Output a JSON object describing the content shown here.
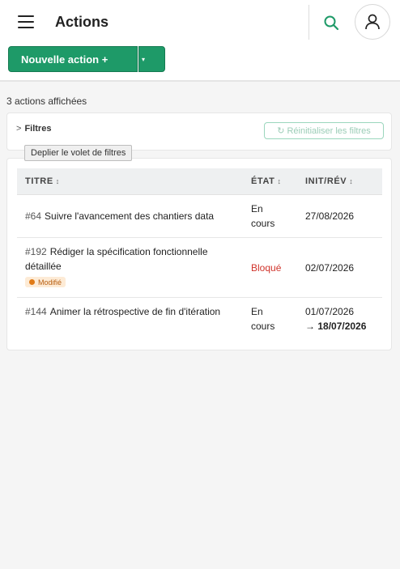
{
  "header": {
    "title": "Actions",
    "menu_icon": "hamburger-menu-icon",
    "search_icon": "search-icon",
    "user_icon": "user-icon"
  },
  "toolbar": {
    "new_action_label": "Nouvelle action +",
    "caret_label": "▾"
  },
  "list": {
    "count_text": "3 actions affichées"
  },
  "filters": {
    "toggle_chevron": ">",
    "toggle_label": "Filtres",
    "reset_icon": "↻",
    "reset_label": "Réinitialiser les filtres",
    "tooltip": "Deplier le volet de filtres"
  },
  "table": {
    "columns": [
      {
        "label": "TITRE",
        "sort": "↕"
      },
      {
        "label": "ÉTAT",
        "sort": "↕"
      },
      {
        "label": "INIT/RÉV",
        "sort": "↕"
      }
    ],
    "rows": [
      {
        "ref": "#64",
        "title": "Suivre l'avancement des chantiers data",
        "state_line1": "En",
        "state_line2": "cours",
        "date_init": "27/08/2026"
      },
      {
        "ref": "#192",
        "title": "Rédiger la spécification fonctionnelle détaillée",
        "badge": "Modifié",
        "state": "Bloqué",
        "date_init": "02/07/2026"
      },
      {
        "ref": "#144",
        "title": "Animer la rétrospective de fin d'itération",
        "state_line1": "En",
        "state_line2": "cours",
        "date_init": "01/07/2026",
        "date_arrow": "→",
        "date_rev": "18/07/2026"
      }
    ]
  },
  "colors": {
    "primary": "#1e9a68",
    "blocked": "#d0332b",
    "badge_bg": "#fdebd6",
    "badge_dot": "#e07a16"
  }
}
